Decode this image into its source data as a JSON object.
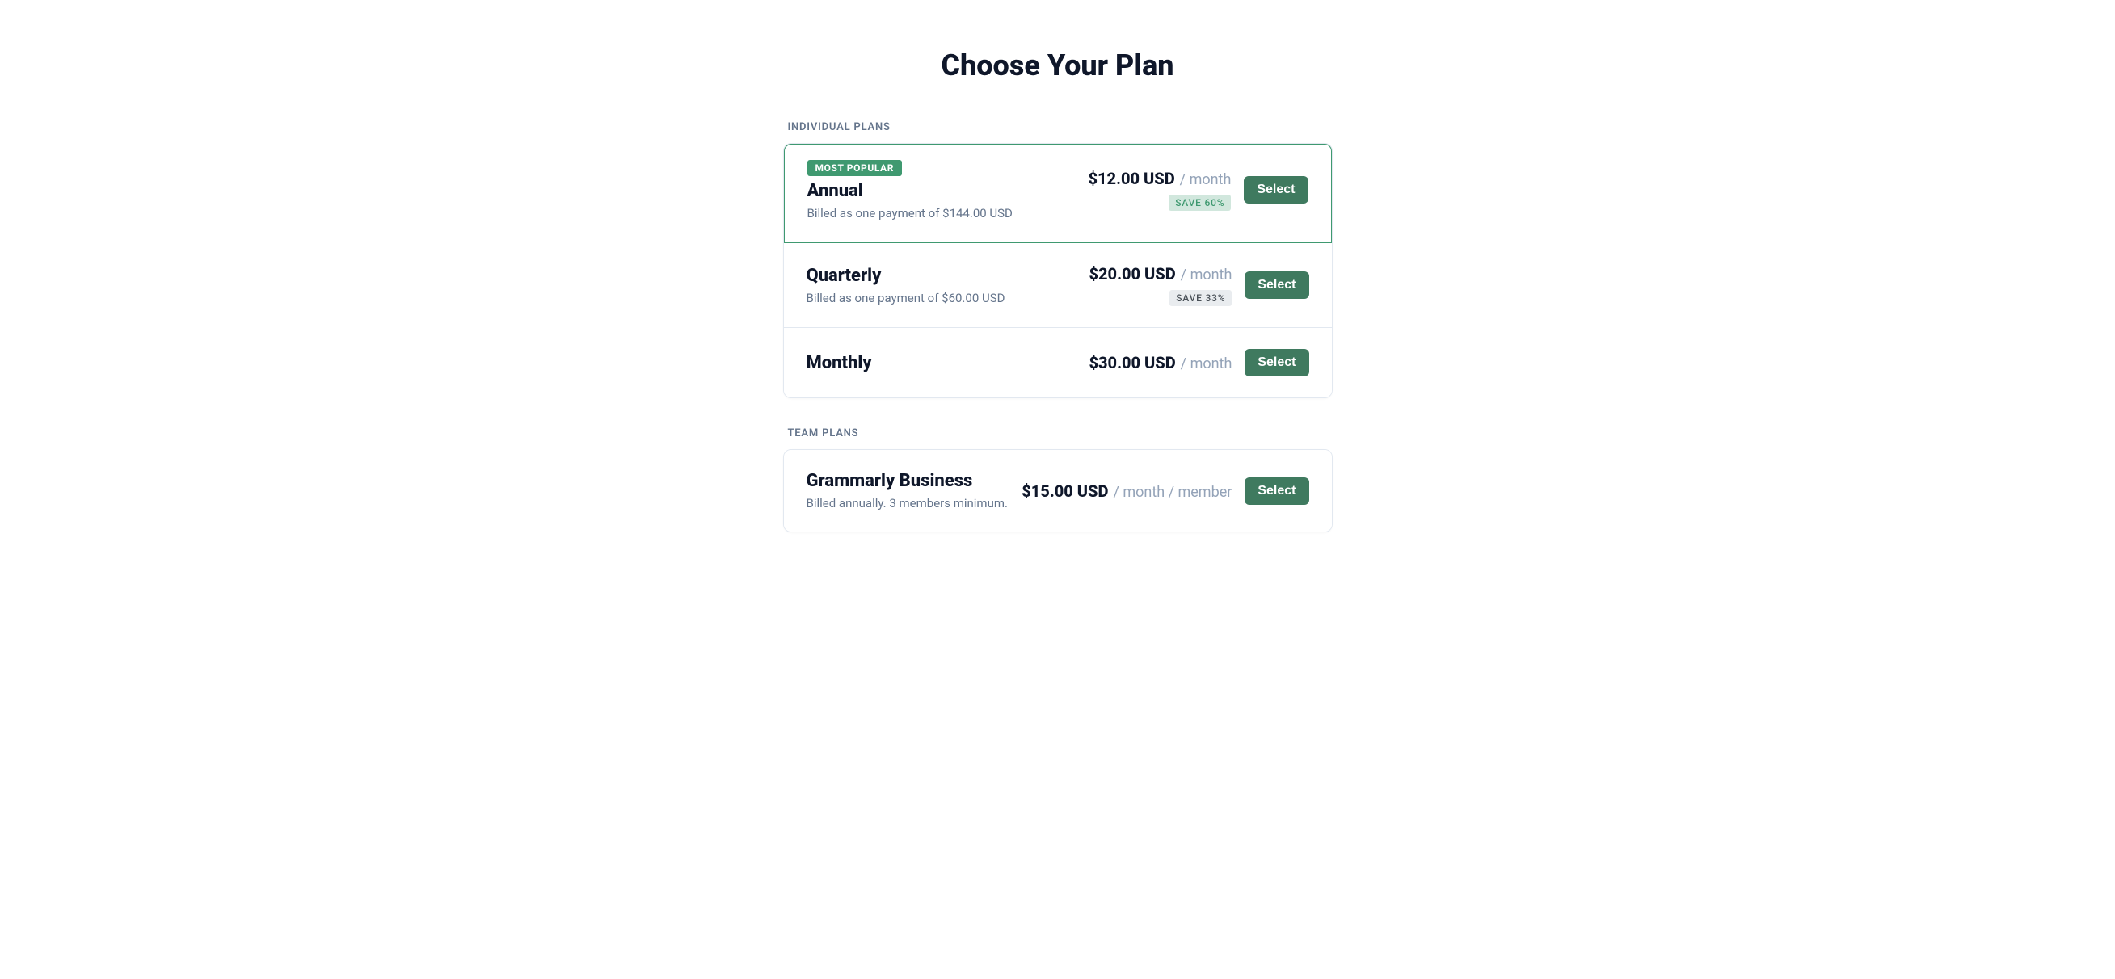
{
  "page_title": "Choose Your Plan",
  "sections": {
    "individual": {
      "label": "INDIVIDUAL PLANS",
      "plans": [
        {
          "badge": "MOST POPULAR",
          "name": "Annual",
          "sub": "Billed as one payment of $144.00 USD",
          "price": "$12.00 USD",
          "suffix": "/ month",
          "save": "SAVE 60%",
          "button": "Select"
        },
        {
          "name": "Quarterly",
          "sub": "Billed as one payment of $60.00 USD",
          "price": "$20.00 USD",
          "suffix": "/ month",
          "save": "SAVE 33%",
          "button": "Select"
        },
        {
          "name": "Monthly",
          "price": "$30.00 USD",
          "suffix": "/ month",
          "button": "Select"
        }
      ]
    },
    "team": {
      "label": "TEAM PLANS",
      "plans": [
        {
          "name": "Grammarly Business",
          "sub": "Billed annually. 3 members minimum.",
          "price": "$15.00 USD",
          "suffix": "/ month / member",
          "button": "Select"
        }
      ]
    }
  }
}
